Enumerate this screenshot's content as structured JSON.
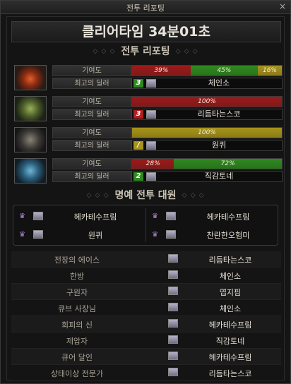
{
  "window": {
    "title": "전투 리포팅",
    "close": "×"
  },
  "clear_time": "클리어타임 34분01초",
  "section_battle": "전투 리포팅",
  "section_honor": "명예 전투 대원",
  "labels": {
    "contribution": "기여도",
    "best_dealer": "최고의 딜러"
  },
  "colors": {
    "red": "#9c1b1b",
    "green": "#2f8a1f",
    "gold": "#a8941a"
  },
  "party": [
    {
      "portrait_icon": "fire-warrior-portrait-icon",
      "rank": "3",
      "rank_color": "#2f8a1f",
      "dealer": "체인소",
      "segments": [
        {
          "label": "39%",
          "pct": 39,
          "color": "#9c1b1b"
        },
        {
          "label": "45%",
          "pct": 45,
          "color": "#2f8a1f"
        },
        {
          "label": "16%",
          "pct": 16,
          "color": "#a8941a"
        }
      ]
    },
    {
      "portrait_icon": "green-armor-portrait-icon",
      "rank": "3",
      "rank_color": "#b31e1e",
      "dealer": "리듬타는스코",
      "segments": [
        {
          "label": "100%",
          "pct": 100,
          "color": "#9c1b1b"
        }
      ]
    },
    {
      "portrait_icon": "dark-armor-portrait-icon",
      "rank": "/",
      "rank_color": "#a8941a",
      "dealer": "원퀴",
      "segments": [
        {
          "label": "100%",
          "pct": 100,
          "color": "#a8941a"
        }
      ]
    },
    {
      "portrait_icon": "blue-armor-portrait-icon",
      "rank": "2",
      "rank_color": "#2f8a1f",
      "dealer": "직감토네",
      "segments": [
        {
          "label": "28%",
          "pct": 28,
          "color": "#9c1b1b"
        },
        {
          "label": "72%",
          "pct": 72,
          "color": "#2f8a1f"
        }
      ]
    }
  ],
  "honor": [
    "헤카테수프림",
    "헤카테수프림",
    "원퀴",
    "찬란한오험미"
  ],
  "awards": [
    {
      "title": "전장의 에이스",
      "name": "리듬타는스코"
    },
    {
      "title": "한방",
      "name": "체인소"
    },
    {
      "title": "구원자",
      "name": "엽지핌"
    },
    {
      "title": "큐브 사장님",
      "name": "체인소"
    },
    {
      "title": "회피의 신",
      "name": "헤카테수프림"
    },
    {
      "title": "제압자",
      "name": "직감토네"
    },
    {
      "title": "큐어 달인",
      "name": "헤카테수프림"
    },
    {
      "title": "상태이상 전문가",
      "name": "리듬타는스코"
    }
  ]
}
